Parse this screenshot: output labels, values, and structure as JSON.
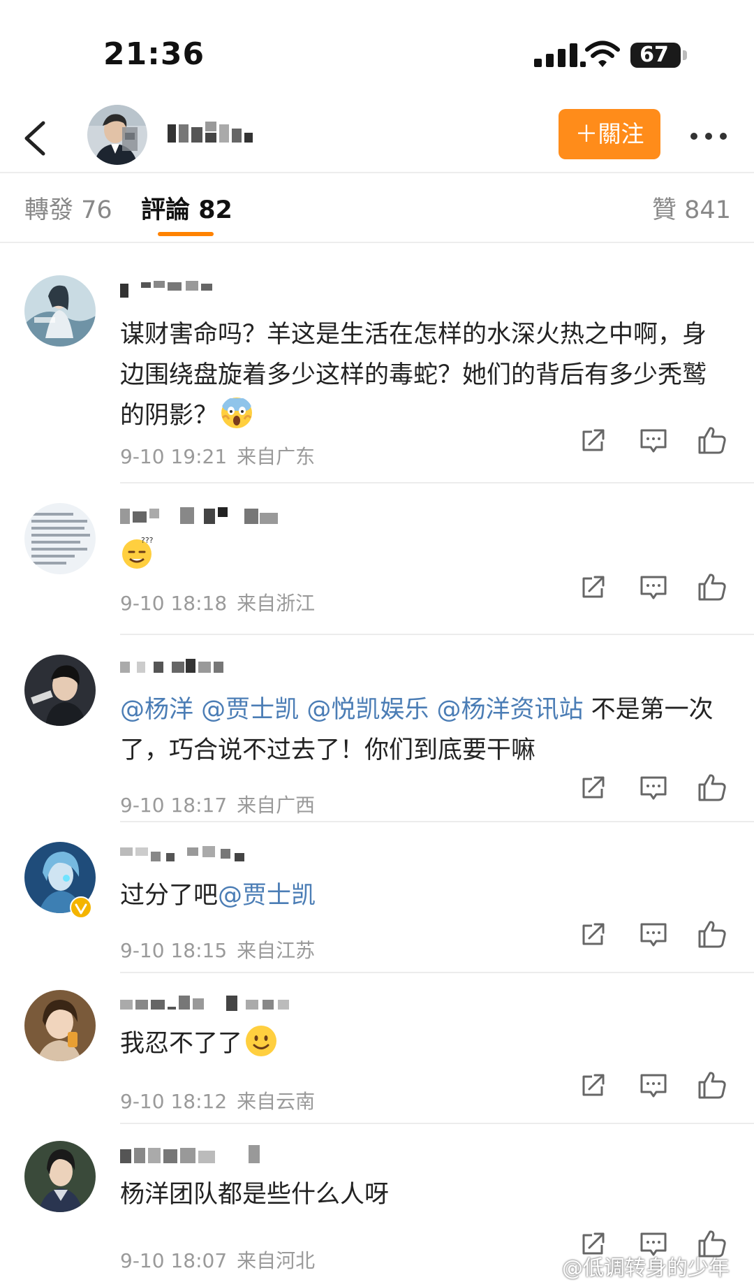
{
  "status_bar": {
    "time": "21:36",
    "battery": "67"
  },
  "tabs": {
    "repost": {
      "label": "轉發",
      "count": "76"
    },
    "comment": {
      "label": "評論",
      "count": "82"
    },
    "like": {
      "label": "贊",
      "count": "841"
    }
  },
  "header": {
    "follow_label": "＋關注"
  },
  "comments": [
    {
      "text": "谋财害命吗？羊这是生活在怎样的水深火热之中啊，身边围绕盘旋着多少这样的毒蛇？她们的背后有多少秃鹫的阴影？",
      "date": "9-10 19:21",
      "location": "来自广东"
    },
    {
      "date": "9-10 18:18",
      "location": "来自浙江"
    },
    {
      "mentions": [
        "@杨洋",
        "@贾士凯",
        "@悦凯娱乐",
        "@杨洋资讯站"
      ],
      "text": "不是第一次了，巧合说不过去了！你们到底要干嘛",
      "date": "9-10 18:17",
      "location": "来自广西"
    },
    {
      "text": "过分了吧",
      "mention": "@贾士凯",
      "date": "9-10 18:15",
      "location": "来自江苏"
    },
    {
      "text": "我忍不了了",
      "date": "9-10 18:12",
      "location": "来自云南"
    },
    {
      "text": "杨洋团队都是些什么人呀",
      "date": "9-10 18:07",
      "location": "来自河北"
    }
  ],
  "watermark": "@低调转身的少年",
  "icons": {
    "back": "chevron-left-icon",
    "more": "more-dots-icon",
    "share": "share-icon",
    "reply": "comment-icon",
    "like": "thumbs-up-icon"
  },
  "colors": {
    "accent": "#ff8200",
    "follow_button": "#ff8c1a",
    "mention": "#4b7db5",
    "meta": "#9a9a9a"
  }
}
